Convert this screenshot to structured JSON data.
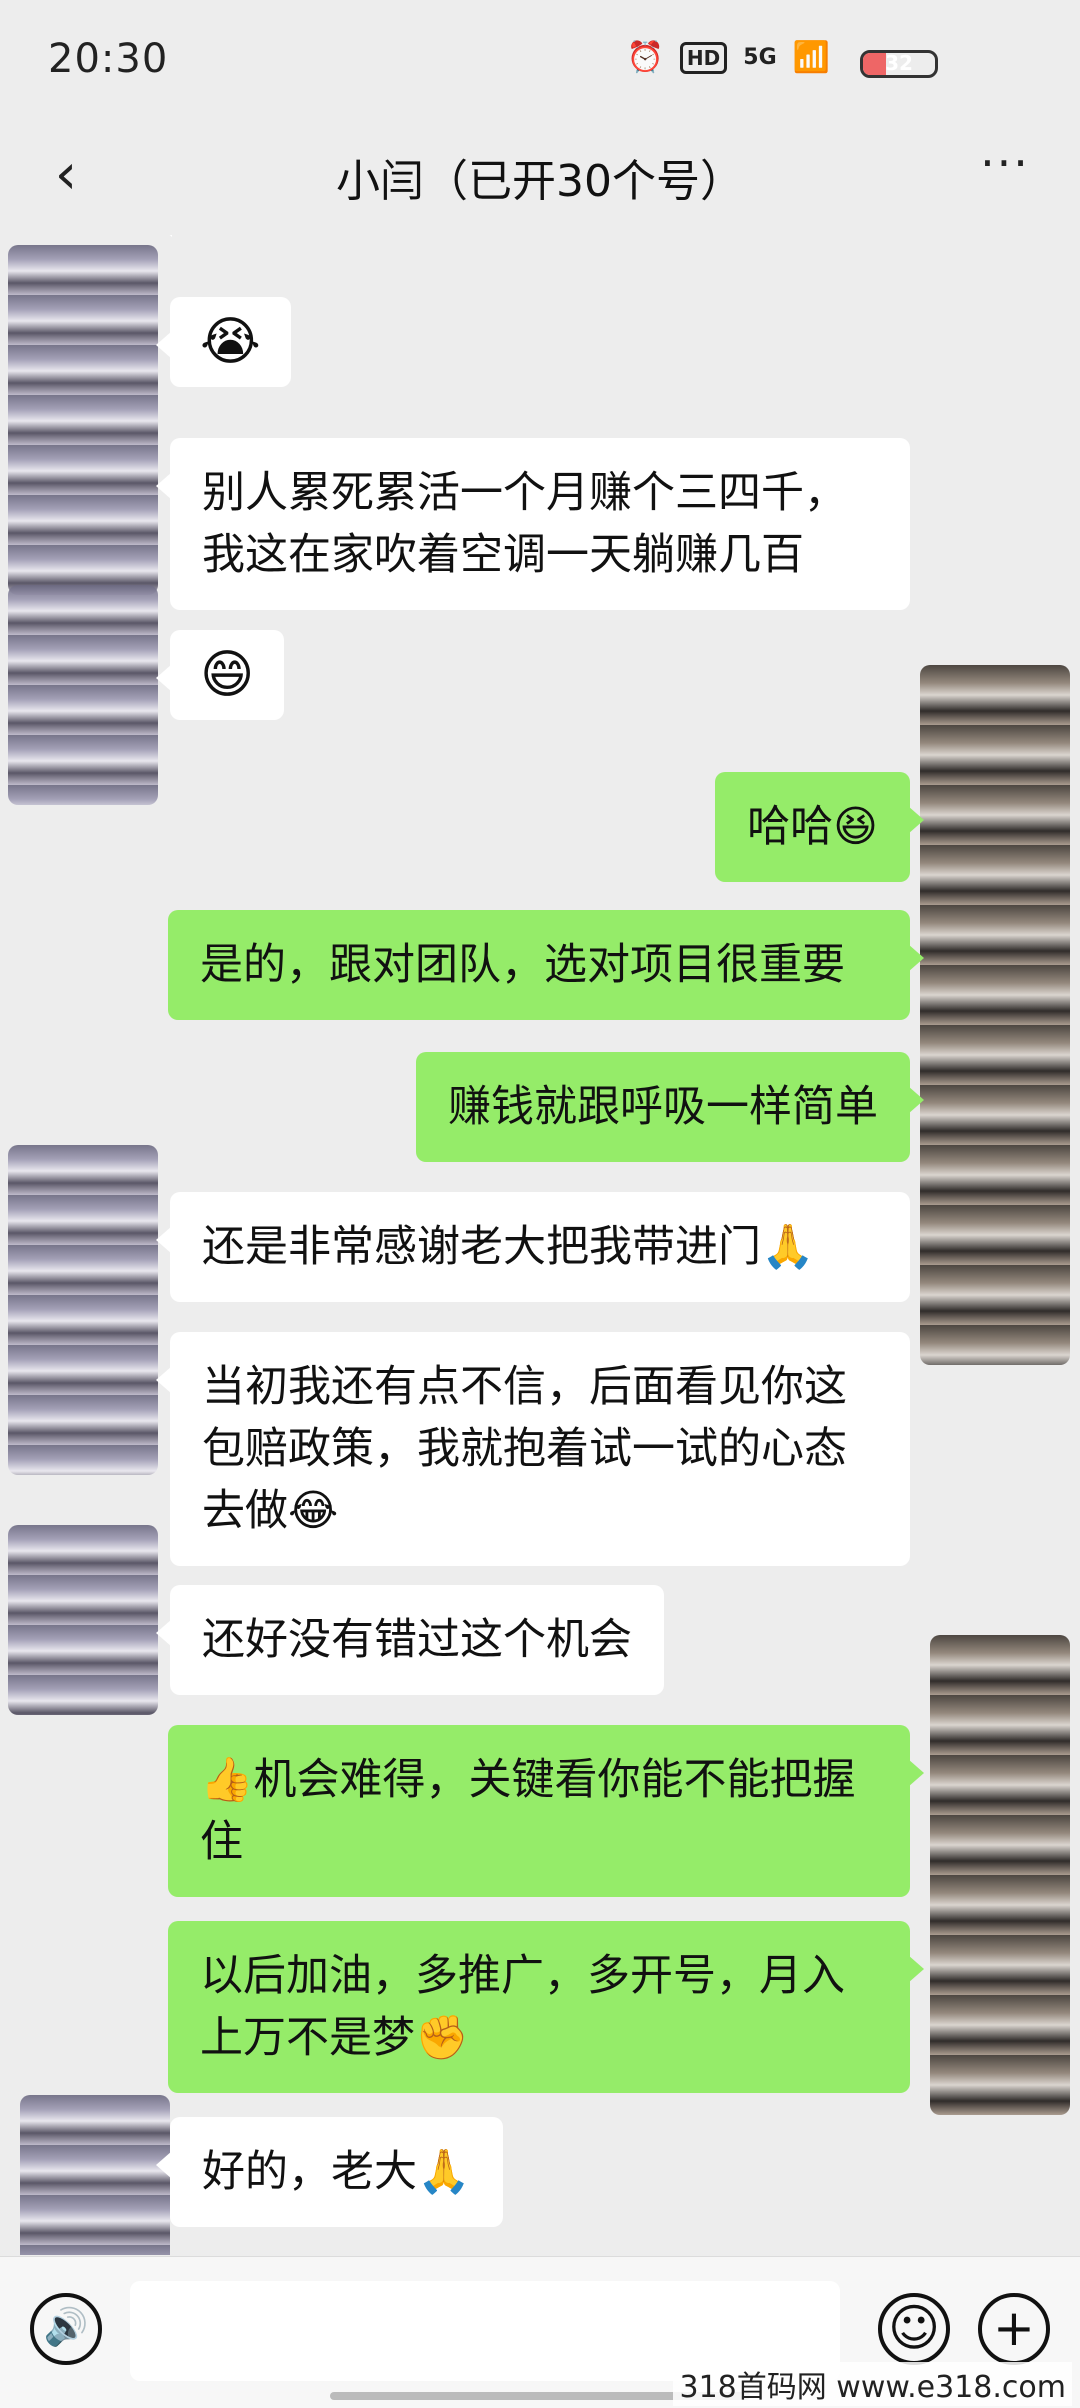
{
  "status": {
    "time": "20:30",
    "hd": "HD",
    "network": "5G",
    "battery": "32"
  },
  "header": {
    "back": "‹",
    "title": "小闫（已开30个号）",
    "more": "···"
  },
  "messages": [
    {
      "dir": "in",
      "text": "😭"
    },
    {
      "dir": "in",
      "text": "别人累死累活一个月赚个三四千，\n我这在家吹着空调一天躺赚几百"
    },
    {
      "dir": "in",
      "text": "😄"
    },
    {
      "dir": "out",
      "text": "哈哈😆"
    },
    {
      "dir": "out",
      "text": "是的，跟对团队，选对项目很重要"
    },
    {
      "dir": "out",
      "text": "赚钱就跟呼吸一样简单"
    },
    {
      "dir": "in",
      "text": "还是非常感谢老大把我带进门🙏"
    },
    {
      "dir": "in",
      "text": "当初我还有点不信，后面看见你这包赔政策，我就抱着试一试的心态去做😂"
    },
    {
      "dir": "in",
      "text": "还好没有错过这个机会"
    },
    {
      "dir": "out",
      "text": "👍机会难得，关键看你能不能把握住"
    },
    {
      "dir": "out",
      "text": "以后加油，多推广，多开号，月入上万不是梦✊"
    },
    {
      "dir": "in",
      "text": "好的，老大🙏"
    }
  ],
  "input": {
    "voice_icon": "🔊",
    "emoji_icon": "☺",
    "plus_icon": "+"
  },
  "watermark": "318首码网 www.e318.com"
}
